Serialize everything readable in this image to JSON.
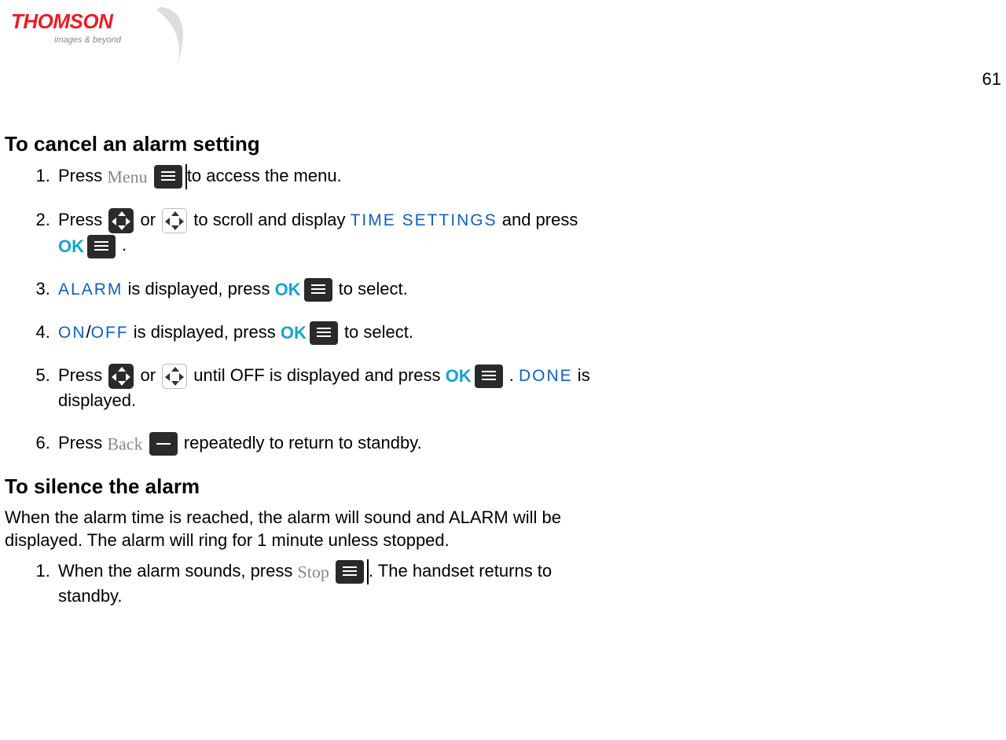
{
  "logo": {
    "brand": "THOMSON",
    "tagline": "images & beyond"
  },
  "page_number": "61",
  "section1": {
    "heading": "To cancel an alarm setting"
  },
  "icons": {
    "menu_label": "Menu",
    "ok_label": "OK",
    "back_label": "Back",
    "stop_label": "Stop"
  },
  "steps1": {
    "s1a": "Press ",
    "s1b": "to access the menu.",
    "s2a": "Press ",
    "s2b": " or ",
    "s2c": " to scroll and display ",
    "s2_highlight": "TIME SETTINGS",
    "s2d": " and press",
    "s2e": " .",
    "s3_highlight": "ALARM",
    "s3a": " is displayed, press ",
    "s3b": " to select.",
    "s4_highlight1": "ON",
    "s4_slash": "/",
    "s4_highlight2": "OFF",
    "s4a": " is displayed, press ",
    "s4b": " to select.",
    "s5a": "Press ",
    "s5b": " or ",
    "s5c": " until OFF is displayed and press",
    "s5d": " .  ",
    "s5_highlight": "DONE",
    "s5e": " is displayed.",
    "s6a": "Press ",
    "s6b": " repeatedly to return to standby."
  },
  "section2": {
    "heading": "To silence the alarm",
    "para": "When the alarm time is reached, the alarm will sound and ALARM will be displayed.  The alarm will ring for 1 minute unless stopped."
  },
  "steps2": {
    "s1a": "When the alarm sounds, press ",
    "s1b": ".  The handset returns to standby."
  }
}
